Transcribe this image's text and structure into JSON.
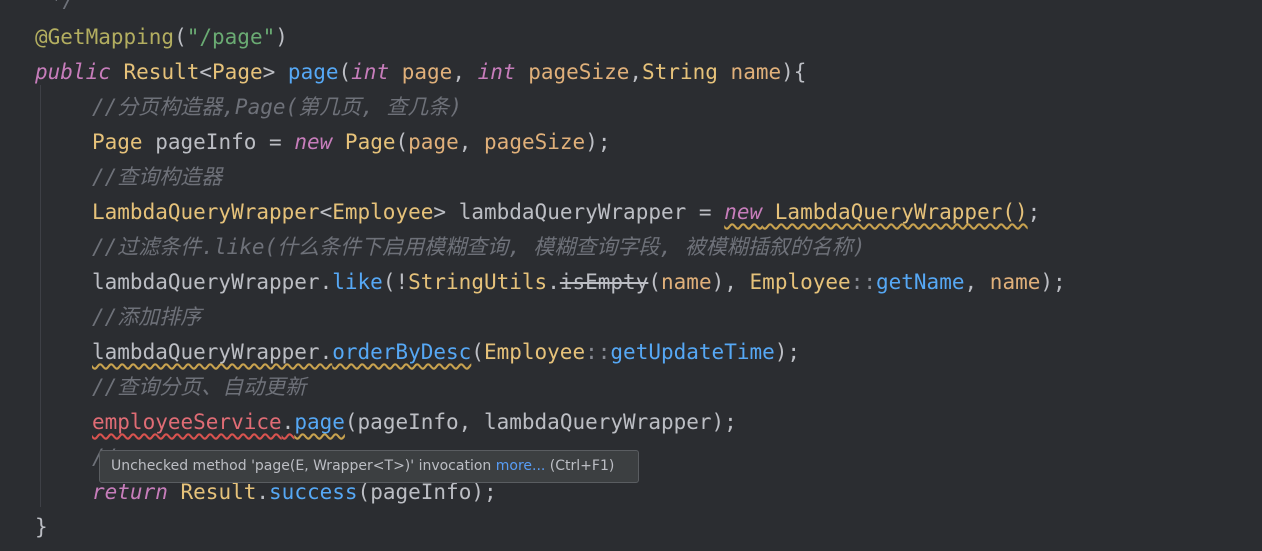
{
  "code": {
    "l0": "*/",
    "l1": {
      "annotation": "@GetMapping",
      "open": "(",
      "string": "\"/page\"",
      "close": ")"
    },
    "l2": {
      "public": "public",
      "result": "Result",
      "lt": "<",
      "page_type": "Page",
      "gt": ">",
      "method": "page",
      "open": "(",
      "int1": "int",
      "p1": "page",
      "comma1": ", ",
      "int2": "int",
      "p2": "pageSize",
      "comma2": ",",
      "string_type": "String",
      "p3": "name",
      "close": "){"
    },
    "l3": "//分页构造器,Page(第几页, 查几条)",
    "l4": {
      "type": "Page",
      "var": "pageInfo",
      "eq": " = ",
      "new": "new",
      "type2": "Page",
      "open": "(",
      "a1": "page",
      "comma": ", ",
      "a2": "pageSize",
      "close": ");"
    },
    "l5": "//查询构造器",
    "l6": {
      "type": "LambdaQueryWrapper",
      "lt": "<",
      "gtype": "Employee",
      "gt": ">",
      "var": " lambdaQueryWrapper",
      "eq": " = ",
      "new": "new",
      "ctor": " LambdaQueryWrapper()",
      "semi": ";"
    },
    "l7": "//过滤条件.like(什么条件下启用模糊查询, 模糊查询字段, 被模糊插叙的名称)",
    "l8": {
      "var": "lambdaQueryWrapper",
      "dot": ".",
      "method": "like",
      "open": "(!",
      "cls": "StringUtils",
      "dot2": ".",
      "deprecated": "isEmpty",
      "open2": "(",
      "a1": "name",
      "close2": "), ",
      "emp": "Employee",
      "sep": "::",
      "ref": "getName",
      "comma": ", ",
      "a2": "name",
      "close": ");"
    },
    "l9": "//添加排序",
    "l10": {
      "var": "lambdaQueryWrapper.",
      "method": "orderByDesc",
      "open": "(",
      "emp": "Employee",
      "sep": "::",
      "ref": "getUpdateTime",
      "close": ");"
    },
    "l11": "//查询分页、自动更新",
    "l12": {
      "field": "employeeService",
      "dot": ".",
      "method": "page",
      "args": "(pageInfo, lambdaQueryWrapper);"
    },
    "l13": "//",
    "l14": {
      "return": "return",
      "result": "Result",
      "dot": ".",
      "method": "success",
      "args": "(pageInfo);"
    },
    "l15": "}"
  },
  "tooltip": {
    "message": "Unchecked method 'page(E, Wrapper<T>)' invocation ",
    "more": "more...",
    "shortcut": " (Ctrl+F1)"
  }
}
